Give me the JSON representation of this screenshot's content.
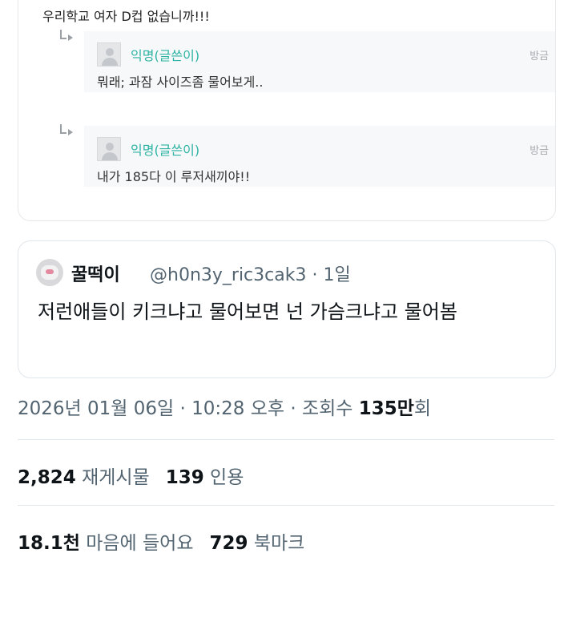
{
  "embedded_post": {
    "first_line": "우리학교 여자 D컵 없습니까!!!",
    "replies": [
      {
        "author": "익명(글쓴이)",
        "report": "방금",
        "text": "뭐래; 과잠 사이즈좀 물어보게.."
      },
      {
        "author": "익명(글쓴이)",
        "report": "방금",
        "text": "내가 185다 이 루저새끼야!!"
      }
    ]
  },
  "quote_tweet": {
    "display_name": "꿀떡이",
    "handle": "@h0n3y_ric3cak3",
    "separator": "·",
    "time": "1일",
    "text": "저런애들이 키크냐고 물어보면 넌 가슴크냐고 물어봄"
  },
  "meta": {
    "datetime": "2026년 01월 06일 · 10:28 오후 · 조회수 ",
    "views_number": "135만",
    "views_suffix": "회"
  },
  "stats": {
    "reposts_count": "2,824",
    "reposts_label": "재게시물",
    "quotes_count": "139",
    "quotes_label": "인용",
    "likes_count": "18.1천",
    "likes_label": "마음에 들어요",
    "bookmarks_count": "729",
    "bookmarks_label": "북마크"
  },
  "colors": {
    "accent_author": "#2bb3a3",
    "text_primary": "#0f1419",
    "text_secondary": "#536471"
  }
}
